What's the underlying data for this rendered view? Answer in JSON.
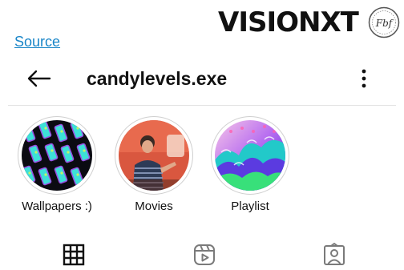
{
  "branding": {
    "logo_text": "VISIONXT",
    "seal_text": "Fbf"
  },
  "source_link": "Source",
  "header": {
    "back_icon": "arrow-left-icon",
    "username": "candylevels.exe",
    "menu_icon": "more-vertical-icon"
  },
  "highlights": [
    {
      "label": "Wallpapers :)"
    },
    {
      "label": "Movies"
    },
    {
      "label": "Playlist"
    }
  ],
  "tabs": [
    {
      "icon": "grid-icon",
      "selected": true
    },
    {
      "icon": "reels-icon",
      "selected": false
    },
    {
      "icon": "tagged-icon",
      "selected": false
    }
  ]
}
